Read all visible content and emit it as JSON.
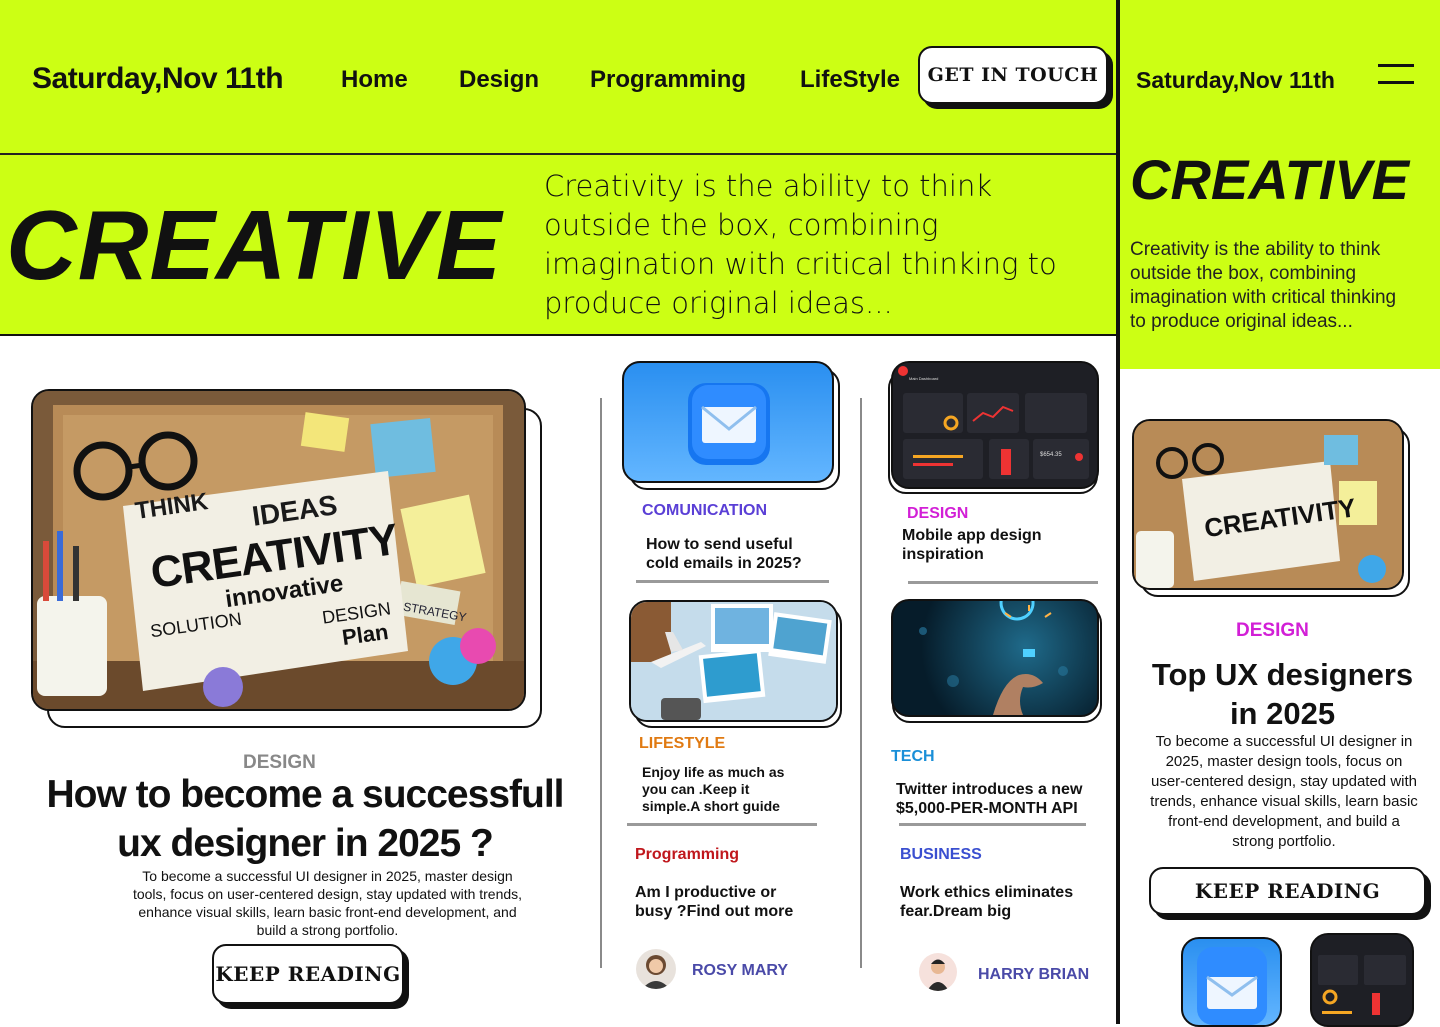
{
  "header": {
    "date": "Saturday,Nov 11th",
    "nav": [
      "Home",
      "Design",
      "Programming",
      "LifeStyle"
    ],
    "cta": "GET IN TOUCH"
  },
  "hero": {
    "heading": "CREATIVE",
    "text_lines": [
      "Creativity is the ability to think",
      "outside the box, combining",
      "imagination with critical thinking to",
      "produce original ideas..."
    ]
  },
  "featured": {
    "category": "DESIGN",
    "title_lines": [
      "How to become a successfull",
      "ux designer in 2025 ?"
    ],
    "body_lines": [
      "To become a successful UI designer in 2025, master design",
      "tools, focus on user-centered design, stay updated with trends,",
      "enhance visual skills, learn basic front-end development, and",
      "build a strong portfolio."
    ],
    "button": "KEEP READING",
    "image_words": [
      "THINK",
      "IDEAS",
      "CREATIVITY",
      "innovative",
      "SOLUTION",
      "DESIGN",
      "Plan",
      "STRATEGY"
    ]
  },
  "col1": {
    "articles": [
      {
        "category": "COMUNICATION",
        "title_lines": [
          "How to send useful",
          "cold emails in 2025?"
        ]
      },
      {
        "category": "LIFESTYLE",
        "title_lines": [
          "Enjoy life as much as",
          "you can .Keep it",
          "simple.A short guide"
        ]
      },
      {
        "category": "Programming",
        "title_lines": [
          "Am I productive or",
          "busy ?Find out more"
        ]
      }
    ],
    "author": "ROSY MARY"
  },
  "col2": {
    "articles": [
      {
        "category": "DESIGN",
        "title_lines": [
          "Mobile app design",
          "inspiration"
        ]
      },
      {
        "category": "TECH",
        "title_lines": [
          "Twitter introduces a new",
          "$5,000-PER-MONTH API"
        ]
      },
      {
        "category": "BUSINESS",
        "title_lines": [
          "Work ethics eliminates",
          "fear.Dream big"
        ]
      }
    ],
    "author": "HARRY BRIAN",
    "dashboard_title": "Main Dashboard",
    "dashboard_value": "$654.35"
  },
  "mobile": {
    "date": "Saturday,Nov 11th",
    "heading": "CREATIVE",
    "text_lines": [
      "Creativity is the ability to think",
      "outside the box, combining",
      "imagination with critical thinking",
      "to produce original ideas..."
    ],
    "category": "DESIGN",
    "title_lines": [
      "Top UX designers",
      "in 2025"
    ],
    "body_lines": [
      "To become a successful UI designer in",
      "2025, master design tools, focus on",
      "user-centered design, stay updated with",
      "trends, enhance visual skills, learn basic",
      "front-end development, and build a",
      "strong portfolio."
    ],
    "button": "KEEP READING"
  },
  "colors": {
    "accent": "#ccff14",
    "communication": "#5a3fd6",
    "design": "#d21fd6",
    "lifestyle": "#e07a12",
    "programming": "#c0171c",
    "tech": "#1a8fd8",
    "business": "#3a4fd0",
    "author": "#4a4aa8"
  }
}
